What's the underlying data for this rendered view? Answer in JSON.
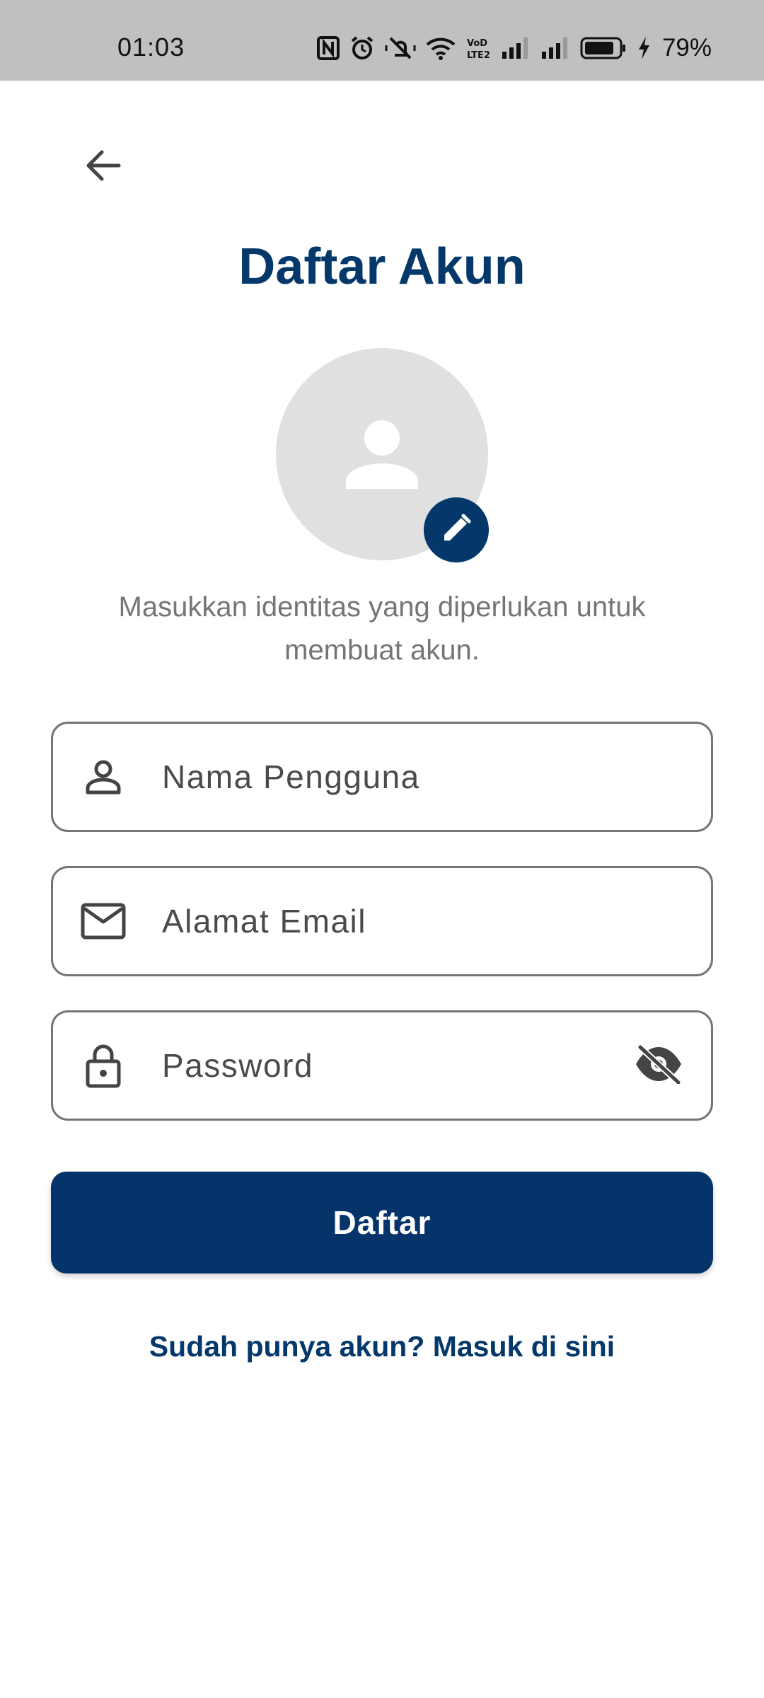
{
  "status_bar": {
    "time": "01:03",
    "battery_percent": "79%",
    "icons": [
      "nfc-icon",
      "alarm-icon",
      "silent-icon",
      "wifi-icon",
      "volte-icon",
      "signal-icon",
      "signal-icon",
      "battery-icon",
      "charging-icon"
    ]
  },
  "header": {
    "back_icon": "arrow-left-icon",
    "title": "Daftar Akun"
  },
  "avatar": {
    "placeholder_icon": "person-icon",
    "edit_icon": "pencil-icon"
  },
  "subtitle": "Masukkan identitas yang diperlukan untuk membuat akun.",
  "form": {
    "username": {
      "placeholder": "Nama Pengguna",
      "value": "",
      "icon": "person-outline-icon"
    },
    "email": {
      "placeholder": "Alamat Email",
      "value": "",
      "icon": "mail-icon"
    },
    "password": {
      "placeholder": "Password",
      "value": "",
      "icon": "lock-icon",
      "toggle_icon": "eye-off-icon"
    }
  },
  "register_button": "Daftar",
  "login_link": "Sudah punya akun? Masuk di sini",
  "colors": {
    "primary": "#04386a",
    "status_bar": "#c0c0c0",
    "avatar_bg": "#e0e0e0",
    "field_border": "#757575",
    "subtitle_text": "#757575"
  }
}
